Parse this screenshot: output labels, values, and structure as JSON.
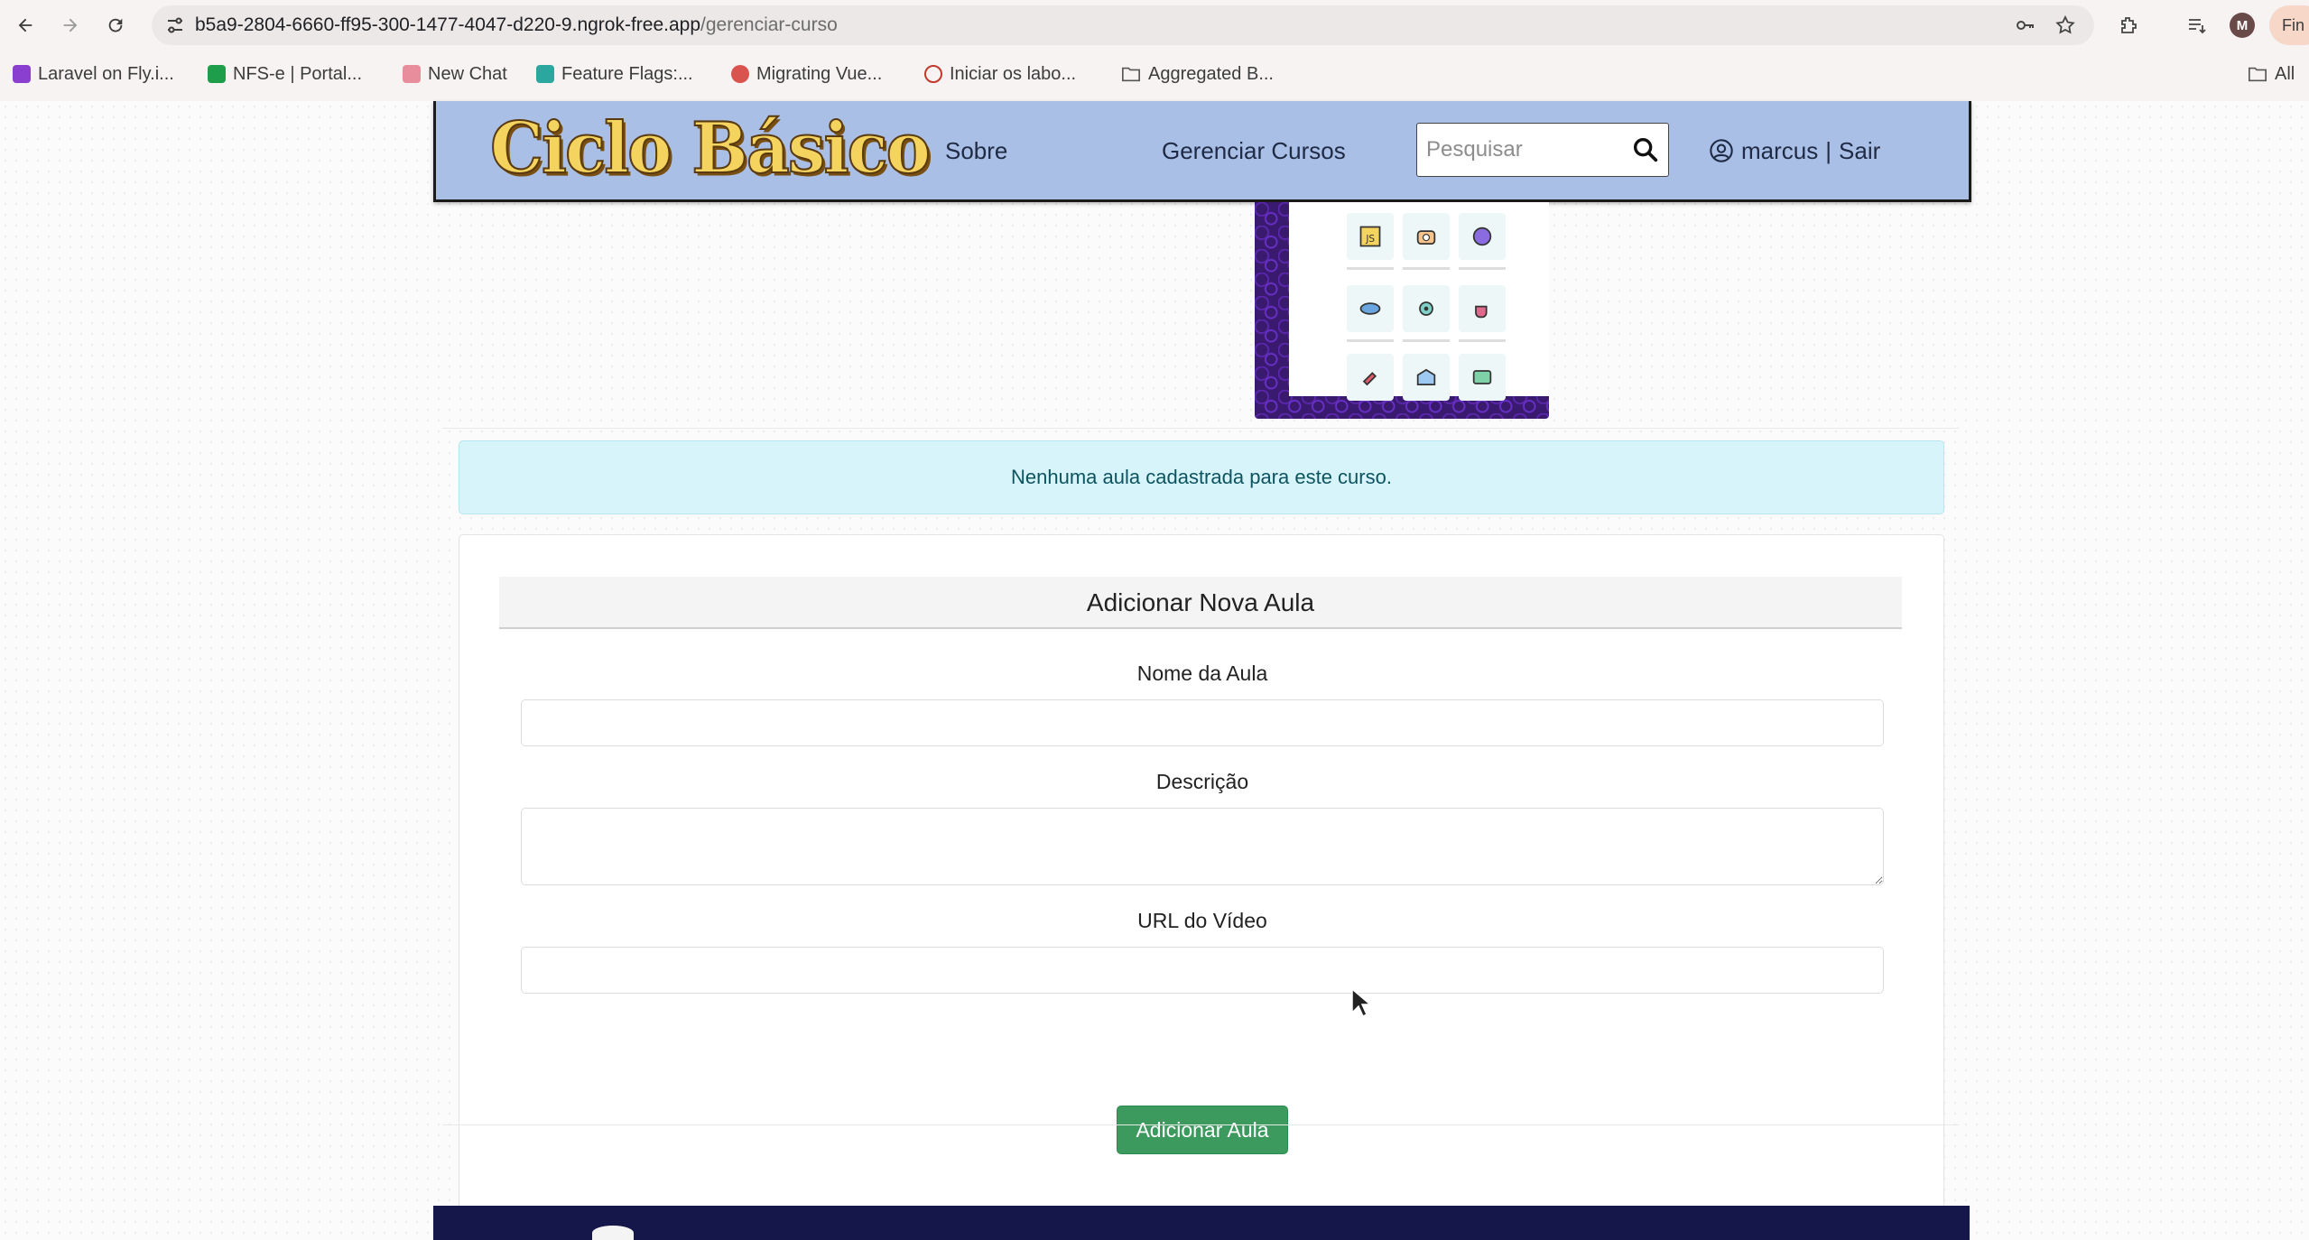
{
  "browser": {
    "url_domain": "b5a9-2804-6660-ff95-300-1477-4047-d220-9.ngrok-free.app",
    "url_path": "/gerenciar-curso",
    "profile_initial": "M",
    "profile_tab_text": "Fin",
    "bookmarks": [
      {
        "label": "Laravel on Fly.i...",
        "icon_color": "#8b3fd1"
      },
      {
        "label": "NFS-e | Portal...",
        "icon_color": "#1e9e4a"
      },
      {
        "label": "New Chat",
        "icon_color": "#e88d9b"
      },
      {
        "label": "Feature Flags:...",
        "icon_color": "#2ba7a0"
      },
      {
        "label": "Migrating Vue...",
        "icon_color": "#d9534f"
      },
      {
        "label": "Iniciar os labo...",
        "icon_color": "#c0392b"
      },
      {
        "label": "Aggregated B...",
        "icon_color": "#555555"
      }
    ],
    "all_bookmarks_label": "All"
  },
  "header": {
    "logo_text": "Ciclo Básico",
    "nav_about": "Sobre",
    "nav_manage": "Gerenciar Cursos",
    "search_placeholder": "Pesquisar",
    "username": "marcus",
    "separator": "|",
    "logout": "Sair"
  },
  "alert": {
    "message": "Nenhuma aula cadastrada para este curso."
  },
  "form": {
    "title": "Adicionar Nova Aula",
    "name_label": "Nome da Aula",
    "name_value": "",
    "description_label": "Descrição",
    "description_value": "",
    "video_label": "URL do Vídeo",
    "video_value": "",
    "submit_label": "Adicionar Aula"
  },
  "colors": {
    "header_bg": "#a9bfe6",
    "alert_bg": "#d6f4f9",
    "submit_bg": "#3d9a5e",
    "footer_bg": "#15174a",
    "logo_yellow": "#f4d35e"
  }
}
